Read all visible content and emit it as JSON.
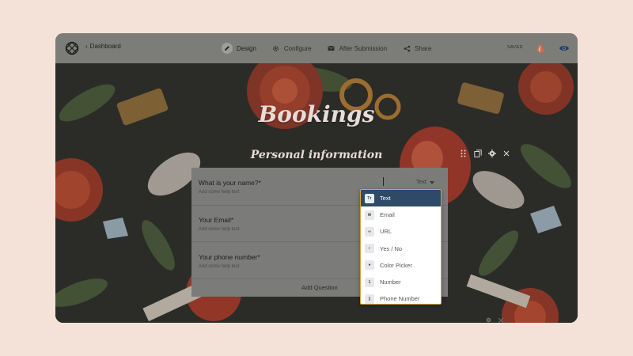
{
  "header": {
    "back_label": "Dashboard",
    "nav": [
      {
        "label": "Design",
        "icon": "pencil-icon"
      },
      {
        "label": "Configure",
        "icon": "gear-icon"
      },
      {
        "label": "After Submission",
        "icon": "envelope-icon"
      },
      {
        "label": "Share",
        "icon": "share-icon"
      }
    ],
    "status": "SAVED"
  },
  "form": {
    "title": "Bookings",
    "section_title": "Personal information",
    "questions": [
      {
        "label": "What is your name?*",
        "help": "Add some help text"
      },
      {
        "label": "Your Email*",
        "help": "Add some help text"
      },
      {
        "label": "Your phone number*",
        "help": "Add some help text"
      }
    ],
    "type_selected": "Text",
    "add_question_label": "Add Question"
  },
  "type_menu": {
    "items": [
      {
        "label": "Text",
        "badge": "Tт",
        "selected": true
      },
      {
        "label": "Email",
        "badge": "✉",
        "selected": false
      },
      {
        "label": "URL",
        "badge": "∞",
        "selected": false
      },
      {
        "label": "Yes / No",
        "badge": "◐",
        "selected": false
      },
      {
        "label": "Color Picker",
        "badge": "●",
        "selected": false
      },
      {
        "label": "Number",
        "badge": "1",
        "selected": false
      },
      {
        "label": "Phone Number",
        "badge": "▯",
        "selected": false
      }
    ]
  },
  "colors": {
    "page_bg": "#f4e2d9",
    "header_bg": "#7c7c78",
    "menu_selected": "#2e4a66",
    "menu_border": "#d9a532",
    "eye_accent": "#1d3f6e",
    "drop_accent": "#d46a4a"
  }
}
